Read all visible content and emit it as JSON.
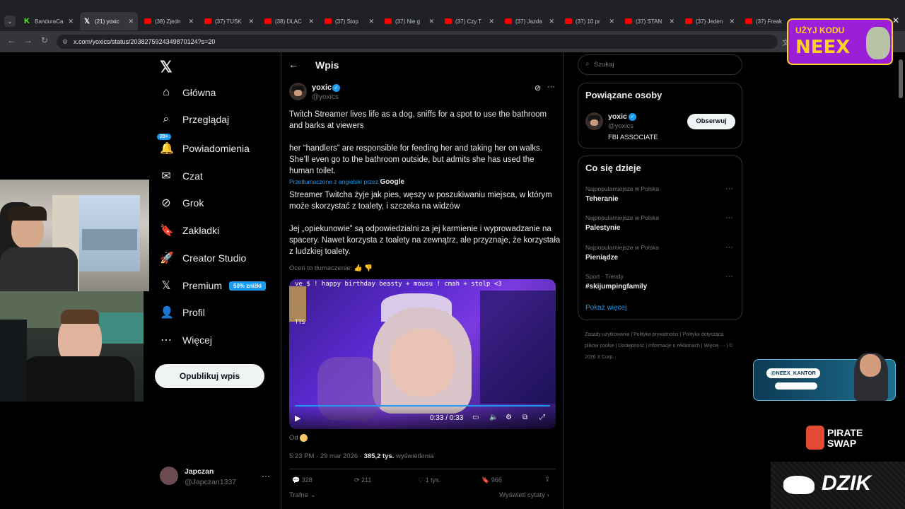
{
  "browser": {
    "tabs": [
      {
        "label": "BanduraCa",
        "icon": "kick-icon"
      },
      {
        "label": "(21) yoxic",
        "icon": "x-icon"
      },
      {
        "label": "(38) Zjedn",
        "icon": "youtube-icon"
      },
      {
        "label": "(37) TUSK",
        "icon": "youtube-icon"
      },
      {
        "label": "(38) DLAC",
        "icon": "youtube-icon"
      },
      {
        "label": "(37) Stop",
        "icon": "youtube-icon"
      },
      {
        "label": "(37) Nie g",
        "icon": "youtube-icon"
      },
      {
        "label": "(37) Czy T",
        "icon": "youtube-icon"
      },
      {
        "label": "(37) Jazda",
        "icon": "youtube-icon"
      },
      {
        "label": "(37) 10 pr",
        "icon": "youtube-icon"
      },
      {
        "label": "(37) STAN",
        "icon": "youtube-icon"
      },
      {
        "label": "(37) Jeden",
        "icon": "youtube-icon"
      },
      {
        "label": "(37) Freak",
        "icon": "youtube-icon"
      }
    ],
    "url": "x.com/yoxics/status/2038275924349870124?s=20"
  },
  "nav": {
    "items": [
      {
        "label": "Główna"
      },
      {
        "label": "Przeglądaj"
      },
      {
        "label": "Powiadomienia",
        "badge": "20+"
      },
      {
        "label": "Czat"
      },
      {
        "label": "Grok"
      },
      {
        "label": "Zakładki"
      },
      {
        "label": "Creator Studio"
      },
      {
        "label": "Premium",
        "badge": "50% zniżki"
      },
      {
        "label": "Profil"
      },
      {
        "label": "Więcej"
      }
    ],
    "publish": "Opublikuj wpis",
    "account": {
      "name": "Japczan",
      "handle": "@Japczan1337"
    }
  },
  "post": {
    "header": "Wpis",
    "author": "yoxic",
    "handle": "@yoxics",
    "text1": "Twitch Streamer lives life as a dog, sniffs for a spot to use the bathroom and barks at viewers",
    "text2": "her “handlers” are responsible for feeding her and taking her on walks. She’ll even go to the bathroom outside, but admits she has used the human toilet.",
    "translated_by": "Przetłumaczone z angielski przez",
    "translator": "Google",
    "trans1": "Streamer Twitcha żyje jak pies, węszy w poszukiwaniu miejsca, w którym może skorzystać z toalety, i szczeka na widzów",
    "trans2": "Jej „opiekunowie” są odpowiedzialni za jej karmienie i wyprowadzanie na spacery. Nawet korzysta z toalety na zewnątrz, ale przyznaje, że korzystała z ludzkiej toalety.",
    "rate": "Oceń to tłumaczenie:",
    "video": {
      "overlay": "ve $ ! happy birthday beasty + mousu ! cmah + stolp <3",
      "time": "0:33 / 0:33",
      "tts": "TTS"
    },
    "from": "Od",
    "timestamp": "5:23 PM · 29 mar 2026 ·",
    "views": "385,2 tys.",
    "views_label": "wyświetlenia",
    "stats": {
      "replies": "328",
      "reposts": "211",
      "likes": "1 tys.",
      "bookmarks": "966"
    },
    "sort": "Trafne",
    "quotes": "Wyświetl cytaty"
  },
  "right": {
    "search_placeholder": "Szukaj",
    "related_title": "Powiązane osoby",
    "related": {
      "name": "yoxic",
      "handle": "@yoxics",
      "bio": "FBI ASSOCIATE",
      "follow": "Obserwuj"
    },
    "trending_title": "Co się dzieje",
    "trends": [
      {
        "context": "Najpopularniejsze w Polska",
        "name": "Teheranie"
      },
      {
        "context": "Najpopularniejsze w Polska",
        "name": "Palestynie"
      },
      {
        "context": "Najpopularniejsze w Polska",
        "name": "Pieniądze"
      },
      {
        "context": "Sport · Trendy",
        "name": "#skijumpingfamily"
      }
    ],
    "show_more": "Pokaż więcej",
    "footer": [
      "Zasady użytkowania",
      "Polityka prywatności",
      "Polityka dotycząca plików cookie",
      "Dostępność",
      "Informacje o reklamach",
      "Więcej ···",
      "© 2026 X Corp."
    ]
  },
  "overlays": {
    "promo_line1": "UŻYJ KODU",
    "promo_line2": "NEEX",
    "kantor": "@NEEX_KANTOR",
    "pirate1": "PIRATE",
    "pirate2": "SWAP",
    "dzik": "DZIK"
  },
  "colors": {
    "accent": "#1d9bf0",
    "promo": "#9b1fd8",
    "promo_text": "#ffd21f"
  }
}
